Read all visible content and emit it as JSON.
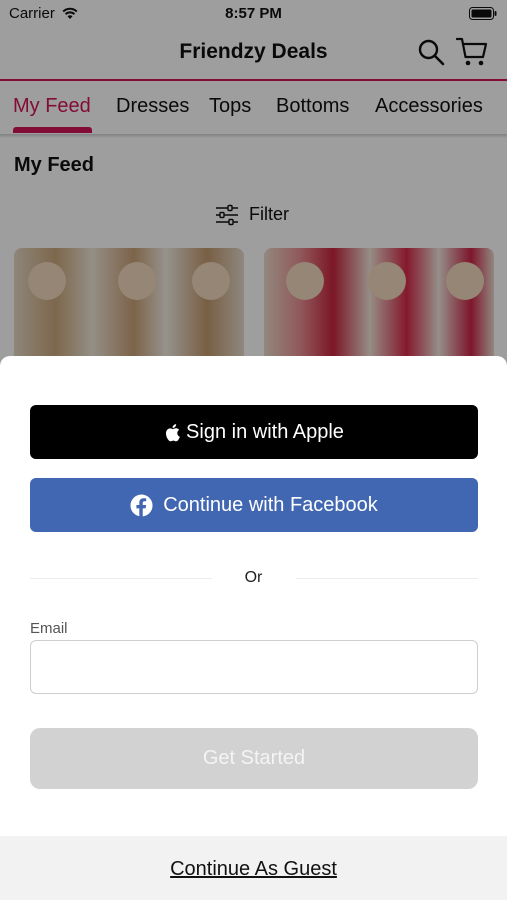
{
  "status_bar": {
    "carrier": "Carrier",
    "time": "8:57 PM"
  },
  "header": {
    "title": "Friendzy Deals"
  },
  "tabs": [
    {
      "label": "My Feed",
      "active": true
    },
    {
      "label": "Dresses",
      "active": false
    },
    {
      "label": "Tops",
      "active": false
    },
    {
      "label": "Bottoms",
      "active": false
    },
    {
      "label": "Accessories",
      "active": false
    }
  ],
  "feed": {
    "heading": "My Feed",
    "filter_label": "Filter"
  },
  "sheet": {
    "apple_label": "Sign in with Apple",
    "facebook_label": "Continue with Facebook",
    "or_label": "Or",
    "email_label": "Email",
    "email_value": "",
    "get_started_label": "Get Started",
    "guest_label": "Continue As Guest"
  },
  "colors": {
    "accent": "#d4145a",
    "facebook": "#4267b2",
    "apple": "#000000",
    "disabled_button": "#d2d2d2"
  },
  "icons": [
    "wifi-icon",
    "battery-icon",
    "search-icon",
    "cart-icon",
    "filter-icon",
    "apple-icon",
    "facebook-icon"
  ]
}
